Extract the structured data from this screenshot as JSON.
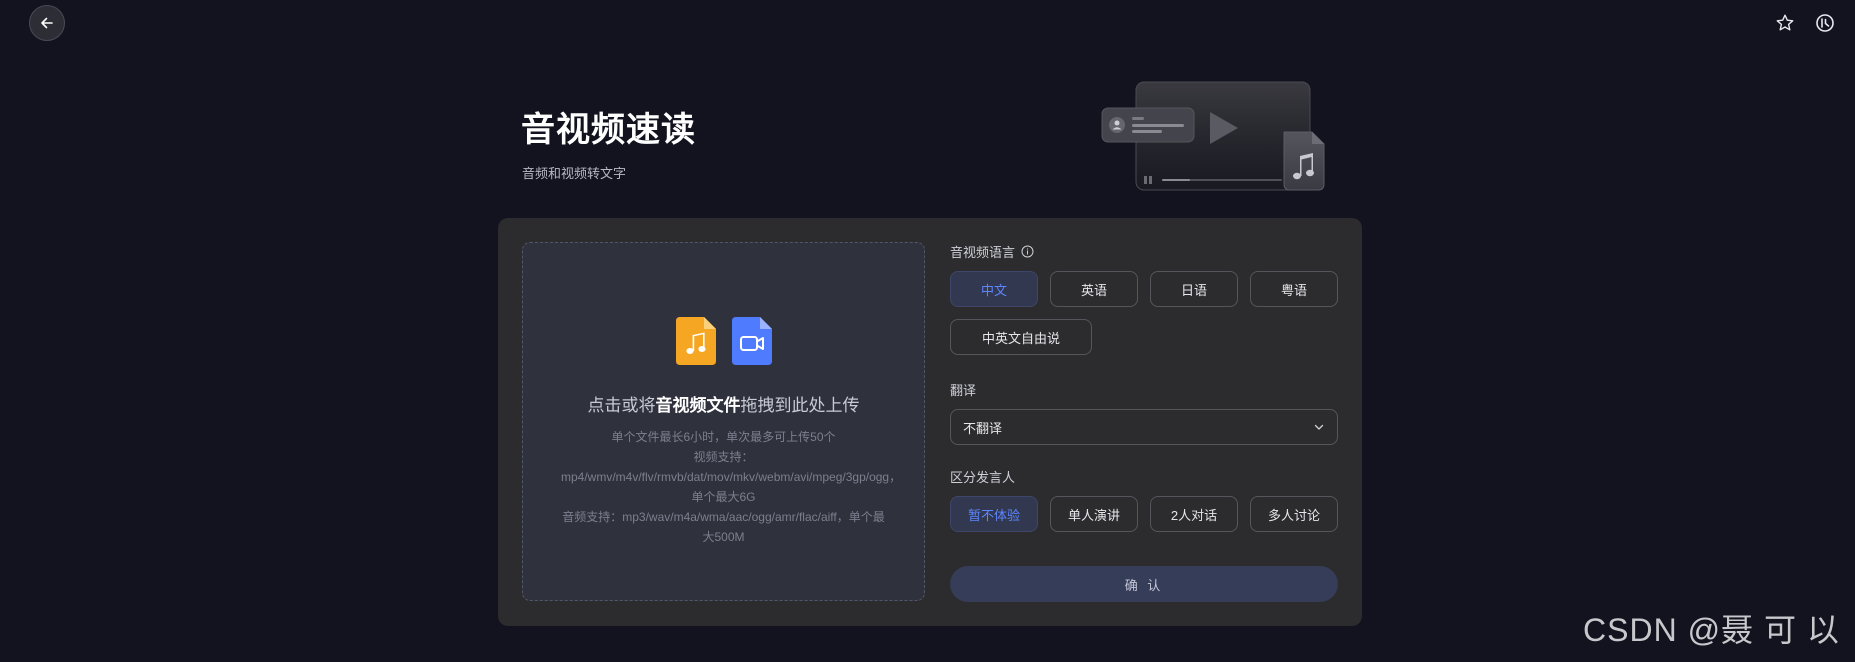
{
  "header": {
    "title": "音视频速读",
    "subtitle": "音频和视频转文字"
  },
  "topbar": {
    "back_icon": "arrow-left-icon",
    "star_icon": "star-icon",
    "history_icon": "history-icon"
  },
  "upload": {
    "prompt_before": "点击或将",
    "prompt_bold": "音视频文件",
    "prompt_after": "拖拽到此处上传",
    "limits": "单个文件最长6小时，单次最多可上传50个",
    "video_support": "视频支持：mp4/wmv/m4v/flv/rmvb/dat/mov/mkv/webm/avi/mpeg/3gp/ogg，单个最大6G",
    "audio_support": "音频支持：mp3/wav/m4a/wma/aac/ogg/amr/flac/aiff，单个最大500M"
  },
  "language": {
    "label": "音视频语言",
    "options": [
      "中文",
      "英语",
      "日语",
      "粤语",
      "中英文自由说"
    ],
    "selected": "中文"
  },
  "translate": {
    "label": "翻译",
    "value": "不翻译"
  },
  "speaker": {
    "label": "区分发言人",
    "options": [
      "暂不体验",
      "单人演讲",
      "2人对话",
      "多人讨论"
    ],
    "selected": "暂不体验"
  },
  "confirm_label": "确 认",
  "watermark": "CSDN @聂 可 以",
  "colors": {
    "background": "#13131f",
    "card": "#2c2c2e",
    "accent": "#5c86ff",
    "audio_file": "#f5a623",
    "video_file": "#4f7bff"
  }
}
